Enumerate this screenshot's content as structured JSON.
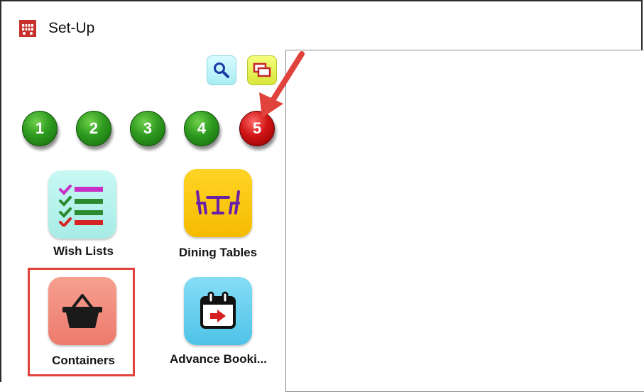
{
  "window": {
    "title": "Set-Up",
    "app_icon": "shopping-cart-icon"
  },
  "toolbar": {
    "search_icon": "magnifier-icon",
    "windows_icon": "cascade-windows-icon"
  },
  "steps": {
    "items": [
      "1",
      "2",
      "3",
      "4",
      "5"
    ],
    "active_index": 5,
    "colors": {
      "inactive": "#2e9a1f",
      "active": "#d11414"
    }
  },
  "tiles": [
    {
      "label": "Wish Lists",
      "icon": "checklist-icon",
      "bg": "#b8f3ef"
    },
    {
      "label": "Dining Tables",
      "icon": "dining-table-icon",
      "bg": "#ffcc00"
    },
    {
      "label": "Containers",
      "icon": "basket-icon",
      "bg": "#f08878"
    },
    {
      "label": "Advance Booki...",
      "icon": "calendar-arrow-icon",
      "bg": "#6fd3ef"
    }
  ],
  "annotation": {
    "arrow_color": "#e0423c",
    "highlight_color": "#e0423c"
  }
}
